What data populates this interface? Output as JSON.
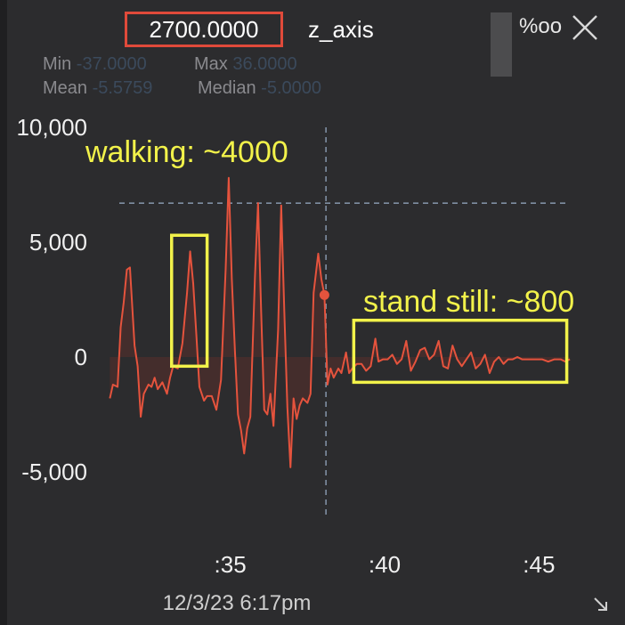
{
  "header": {
    "value": "2700.0000",
    "axis_name": "z_axis",
    "unit_symbol": "%oo"
  },
  "stats": {
    "min_label": "Min",
    "min_value": "-37.0000",
    "max_label": "Max",
    "max_value": "36.0000",
    "mean_label": "Mean",
    "mean_value": "-5.5759",
    "median_label": "Median",
    "median_value": "-5.0000"
  },
  "icons": {
    "close": "close-icon",
    "resize": "resize-corner-icon"
  },
  "colors": {
    "line": "#e5533d",
    "fill": "#5a2f2b",
    "annotation": "#f2f24a",
    "value_box": "#e04a3a",
    "crosshair": "#7f8fa3"
  },
  "chart_data": {
    "type": "line",
    "xlabel": "12/3/23 6:17pm",
    "ylabel": "",
    "xlim": [
      30.8,
      46.2
    ],
    "ylim": [
      -10000,
      10000
    ],
    "x_ticks": [
      {
        "x": 35,
        "label": ":35"
      },
      {
        "x": 40,
        "label": ":40"
      },
      {
        "x": 45,
        "label": ":45"
      }
    ],
    "y_ticks": [
      {
        "y": 10000,
        "label": "10,000"
      },
      {
        "y": 5000,
        "label": "5,000"
      },
      {
        "y": 0,
        "label": "0"
      },
      {
        "y": -5000,
        "label": "-5,000"
      }
    ],
    "crosshair": {
      "x": 38.1,
      "y": 6700
    },
    "marker": {
      "x": 38.05,
      "y": 2700
    },
    "series": [
      {
        "points": [
          [
            31.1,
            -1800
          ],
          [
            31.2,
            -1200
          ],
          [
            31.35,
            -1300
          ],
          [
            31.45,
            1300
          ],
          [
            31.55,
            2400
          ],
          [
            31.65,
            3800
          ],
          [
            31.75,
            3900
          ],
          [
            31.9,
            500
          ],
          [
            32.0,
            -400
          ],
          [
            32.1,
            -2600
          ],
          [
            32.2,
            -1600
          ],
          [
            32.35,
            -1200
          ],
          [
            32.45,
            -1300
          ],
          [
            32.55,
            -900
          ],
          [
            32.65,
            -1400
          ],
          [
            32.8,
            -1100
          ],
          [
            32.95,
            -1600
          ],
          [
            33.05,
            -900
          ],
          [
            33.15,
            -400
          ],
          [
            33.3,
            -500
          ],
          [
            33.45,
            600
          ],
          [
            33.6,
            2800
          ],
          [
            33.7,
            4600
          ],
          [
            33.8,
            3200
          ],
          [
            33.9,
            1000
          ],
          [
            34.0,
            -1300
          ],
          [
            34.15,
            -1900
          ],
          [
            34.25,
            -1700
          ],
          [
            34.4,
            -1700
          ],
          [
            34.55,
            -2300
          ],
          [
            34.7,
            -1000
          ],
          [
            34.85,
            3800
          ],
          [
            34.95,
            7800
          ],
          [
            35.05,
            3400
          ],
          [
            35.15,
            300
          ],
          [
            35.25,
            -2500
          ],
          [
            35.35,
            -3200
          ],
          [
            35.45,
            -4200
          ],
          [
            35.55,
            -3100
          ],
          [
            35.65,
            -2600
          ],
          [
            35.8,
            3500
          ],
          [
            35.9,
            6700
          ],
          [
            36.0,
            2000
          ],
          [
            36.1,
            -2300
          ],
          [
            36.2,
            -2500
          ],
          [
            36.3,
            -1600
          ],
          [
            36.4,
            -3000
          ],
          [
            36.55,
            1200
          ],
          [
            36.65,
            6600
          ],
          [
            36.75,
            2000
          ],
          [
            36.85,
            -2200
          ],
          [
            36.95,
            -4800
          ],
          [
            37.05,
            -1800
          ],
          [
            37.15,
            -2700
          ],
          [
            37.25,
            -2100
          ],
          [
            37.35,
            -1800
          ],
          [
            37.5,
            -2000
          ],
          [
            37.6,
            -1600
          ],
          [
            37.7,
            2800
          ],
          [
            37.85,
            4500
          ],
          [
            37.95,
            3400
          ],
          [
            38.05,
            2700
          ],
          [
            38.15,
            -1200
          ],
          [
            38.25,
            -500
          ],
          [
            38.35,
            -900
          ],
          [
            38.5,
            -500
          ],
          [
            38.6,
            -700
          ],
          [
            38.75,
            200
          ],
          [
            38.85,
            -700
          ],
          [
            38.95,
            -500
          ],
          [
            39.1,
            -300
          ],
          [
            39.25,
            -300
          ],
          [
            39.4,
            -600
          ],
          [
            39.55,
            -400
          ],
          [
            39.7,
            800
          ],
          [
            39.8,
            -200
          ],
          [
            39.95,
            -100
          ],
          [
            40.1,
            -100
          ],
          [
            40.25,
            100
          ],
          [
            40.4,
            -300
          ],
          [
            40.55,
            -100
          ],
          [
            40.7,
            700
          ],
          [
            40.85,
            -600
          ],
          [
            41.0,
            -200
          ],
          [
            41.15,
            300
          ],
          [
            41.3,
            400
          ],
          [
            41.45,
            -100
          ],
          [
            41.6,
            100
          ],
          [
            41.75,
            700
          ],
          [
            41.9,
            -400
          ],
          [
            42.05,
            -500
          ],
          [
            42.2,
            500
          ],
          [
            42.35,
            -100
          ],
          [
            42.5,
            -400
          ],
          [
            42.65,
            -100
          ],
          [
            42.8,
            200
          ],
          [
            42.95,
            -500
          ],
          [
            43.1,
            -300
          ],
          [
            43.25,
            100
          ],
          [
            43.4,
            -700
          ],
          [
            43.55,
            -200
          ],
          [
            43.7,
            0
          ],
          [
            43.85,
            -300
          ],
          [
            44.0,
            -100
          ],
          [
            44.15,
            -100
          ],
          [
            44.3,
            0
          ],
          [
            44.45,
            -100
          ],
          [
            44.6,
            -100
          ],
          [
            44.75,
            -100
          ],
          [
            44.9,
            -100
          ],
          [
            45.1,
            -100
          ],
          [
            45.3,
            -200
          ],
          [
            45.5,
            -100
          ],
          [
            45.7,
            -100
          ],
          [
            45.85,
            -200
          ],
          [
            46.0,
            -100
          ]
        ]
      }
    ],
    "annotations": [
      {
        "text": "walking: ~4000",
        "box": {
          "x0": 33.1,
          "x1": 34.25,
          "y0": -400,
          "y1": 5300
        }
      },
      {
        "text": "stand still: ~800",
        "box": {
          "x0": 39.0,
          "x1": 45.9,
          "y0": -1100,
          "y1": 1600
        }
      }
    ]
  }
}
